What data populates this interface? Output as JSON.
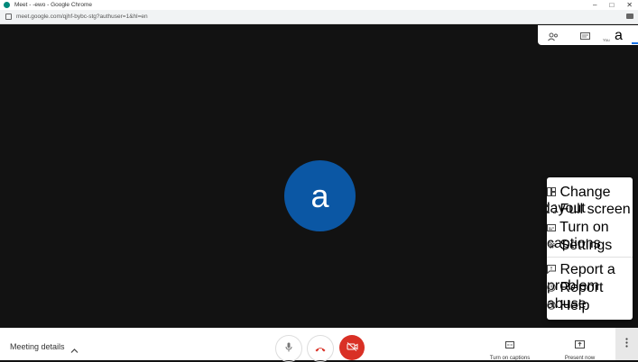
{
  "browser": {
    "window_title": "Meet - -ewo - Google Chrome",
    "url": "meet.google.com/qjhf-bybc-stg?authuser=1&hl=en"
  },
  "top_panel": {
    "you_label": "You",
    "avatar_letter": "a",
    "icons": [
      "people-icon",
      "chat-icon"
    ]
  },
  "stage": {
    "avatar_letter": "a",
    "avatar_color": "#0b57a4"
  },
  "menu": {
    "items": [
      {
        "label": "Change layout",
        "icon": "layout-icon"
      },
      {
        "label": "Full screen",
        "icon": "fullscreen-icon"
      },
      {
        "label": "Turn on captions",
        "icon": "captions-icon"
      },
      {
        "label": "Settings",
        "icon": "gear-icon"
      },
      {
        "label": "Report a problem",
        "icon": "feedback-icon"
      },
      {
        "label": "Report abuse",
        "icon": "warning-icon"
      },
      {
        "label": "Help",
        "icon": "help-icon"
      }
    ]
  },
  "bottom_bar": {
    "meeting_details": "Meeting details",
    "captions_label": "Turn on captions",
    "present_label": "Present now",
    "end_call_color": "#d93025"
  }
}
